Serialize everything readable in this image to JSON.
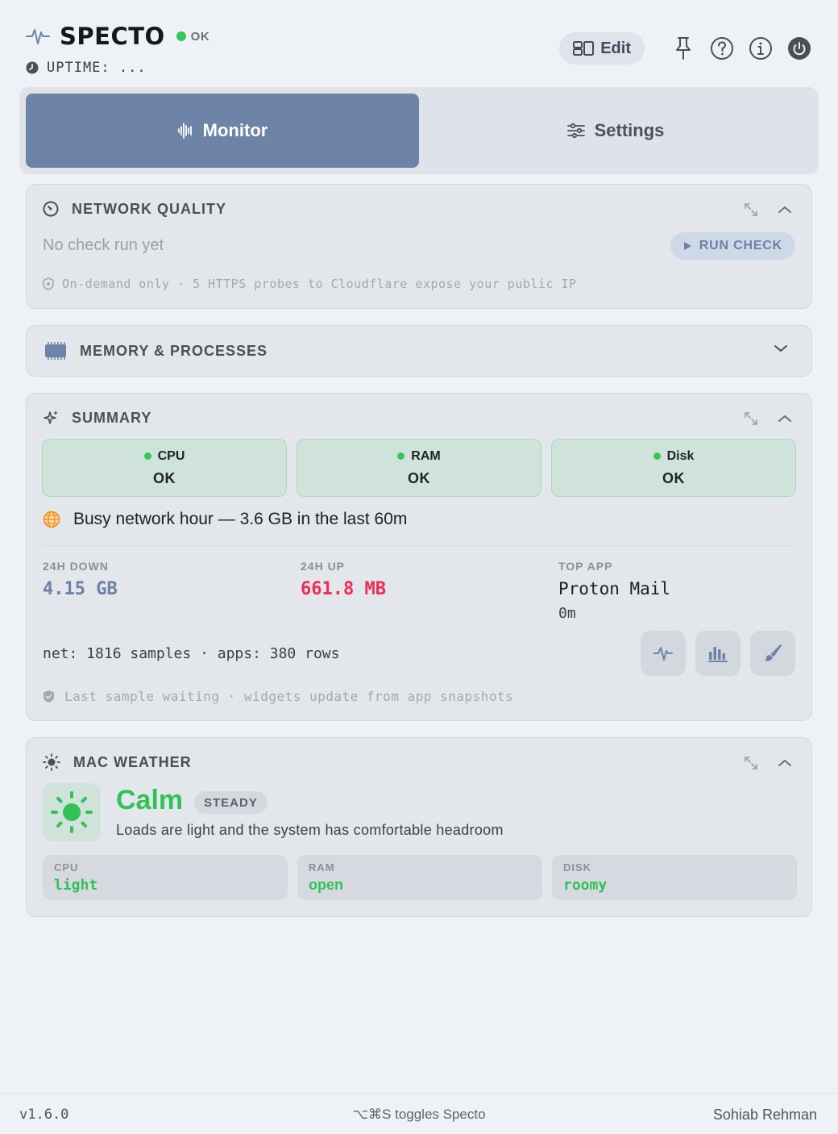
{
  "app": {
    "name": "SPECTO",
    "status": "OK",
    "uptime": "UPTIME: ..."
  },
  "header": {
    "edit_label": "Edit"
  },
  "tabs": [
    {
      "label": "Monitor",
      "active": true
    },
    {
      "label": "Settings",
      "active": false
    }
  ],
  "network_quality": {
    "title": "NETWORK QUALITY",
    "status": "No check run yet",
    "run_button": "RUN CHECK",
    "note": "On-demand only · 5 HTTPS probes to Cloudflare expose your public IP"
  },
  "memory": {
    "title": "MEMORY & PROCESSES"
  },
  "summary": {
    "title": "SUMMARY",
    "tiles": [
      {
        "label": "CPU",
        "value": "OK"
      },
      {
        "label": "RAM",
        "value": "OK"
      },
      {
        "label": "Disk",
        "value": "OK"
      }
    ],
    "busy": "Busy network hour — 3.6 GB in the last 60m",
    "down_label": "24H DOWN",
    "down_value": "4.15 GB",
    "up_label": "24H UP",
    "up_value": "661.8 MB",
    "top_app_label": "TOP APP",
    "top_app_value": "Proton Mail",
    "top_app_sub": "0m",
    "samples": "net: 1816 samples · apps: 380 rows",
    "note": "Last sample waiting · widgets update from app snapshots"
  },
  "weather": {
    "title": "MAC WEATHER",
    "state": "Calm",
    "badge": "STEADY",
    "description": "Loads are light and the system has comfortable headroom",
    "tiles": [
      {
        "label": "CPU",
        "value": "light"
      },
      {
        "label": "RAM",
        "value": "open"
      },
      {
        "label": "DISK",
        "value": "roomy"
      }
    ]
  },
  "footer": {
    "version": "v1.6.0",
    "shortcut": "⌥⌘S toggles Specto",
    "author": "Sohiab Rehman"
  },
  "colors": {
    "accent": "#6e84a6",
    "ok_green": "#34c759",
    "up_red": "#ee2a55"
  }
}
